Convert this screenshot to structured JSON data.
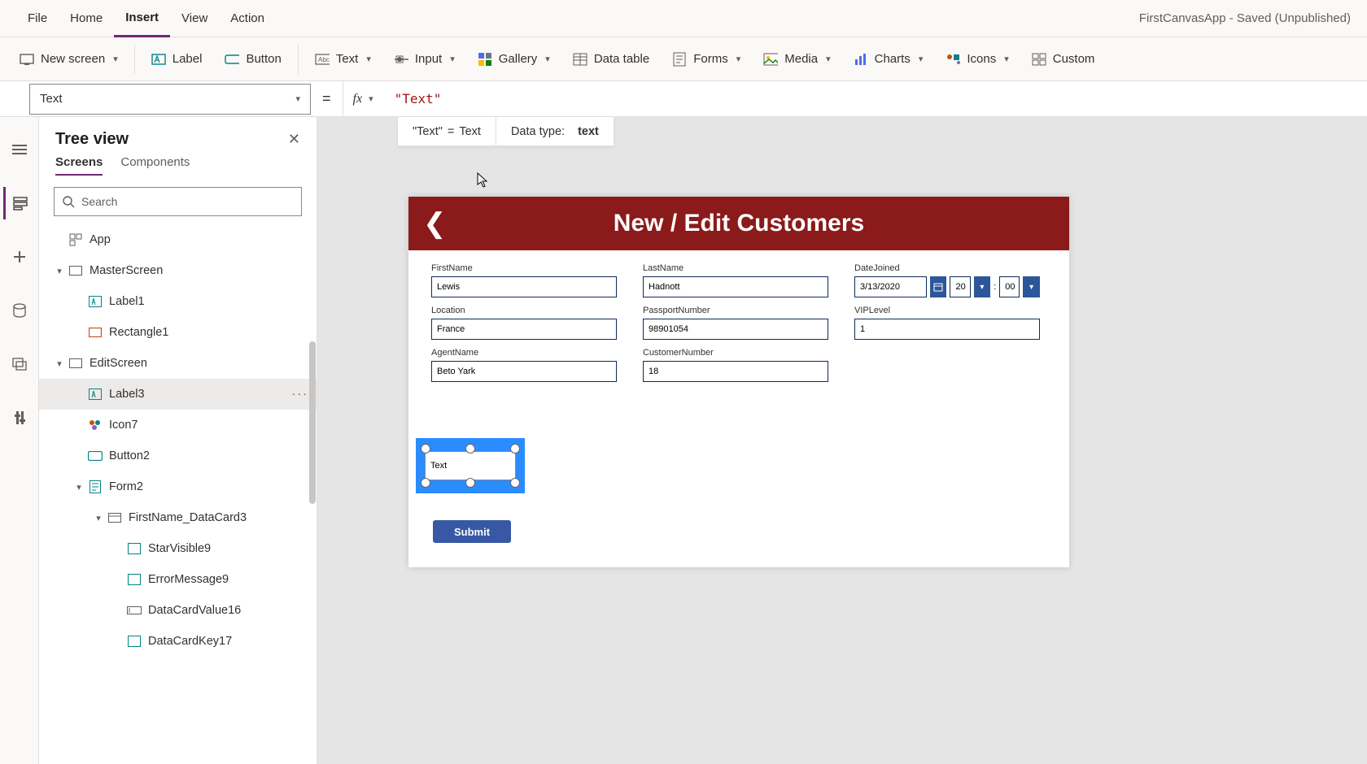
{
  "app_title": "FirstCanvasApp - Saved (Unpublished)",
  "menu": {
    "items": [
      "File",
      "Home",
      "Insert",
      "View",
      "Action"
    ],
    "active": "Insert"
  },
  "ribbon": {
    "new_screen": "New screen",
    "label": "Label",
    "button": "Button",
    "text": "Text",
    "input": "Input",
    "gallery": "Gallery",
    "data_table": "Data table",
    "forms": "Forms",
    "media": "Media",
    "charts": "Charts",
    "icons": "Icons",
    "custom": "Custom"
  },
  "formula": {
    "property": "Text",
    "value": "\"Text\"",
    "hint_left_lit": "\"Text\"",
    "hint_left_eq": "=",
    "hint_left_val": "Text",
    "hint_right_label": "Data type:",
    "hint_right_val": "text"
  },
  "treeview": {
    "title": "Tree view",
    "tabs": {
      "screens": "Screens",
      "components": "Components"
    },
    "search_placeholder": "Search",
    "nodes": {
      "app": "App",
      "master": "MasterScreen",
      "label1": "Label1",
      "rect1": "Rectangle1",
      "edit": "EditScreen",
      "label3": "Label3",
      "icon7": "Icon7",
      "button2": "Button2",
      "form2": "Form2",
      "datacard": "FirstName_DataCard3",
      "star": "StarVisible9",
      "err": "ErrorMessage9",
      "dcval": "DataCardValue16",
      "dckey": "DataCardKey17"
    }
  },
  "screen": {
    "header_title": "New / Edit Customers",
    "fields": {
      "first_name": {
        "label": "FirstName",
        "value": "Lewis"
      },
      "last_name": {
        "label": "LastName",
        "value": "Hadnott"
      },
      "date_joined": {
        "label": "DateJoined",
        "date": "3/13/2020",
        "hour": "20",
        "minute": "00"
      },
      "location": {
        "label": "Location",
        "value": "France"
      },
      "passport": {
        "label": "PassportNumber",
        "value": "98901054"
      },
      "vip": {
        "label": "VIPLevel",
        "value": "1"
      },
      "agent": {
        "label": "AgentName",
        "value": "Beto Yark"
      },
      "custnum": {
        "label": "CustomerNumber",
        "value": "18"
      }
    },
    "selected_label_text": "Text",
    "submit": "Submit"
  }
}
